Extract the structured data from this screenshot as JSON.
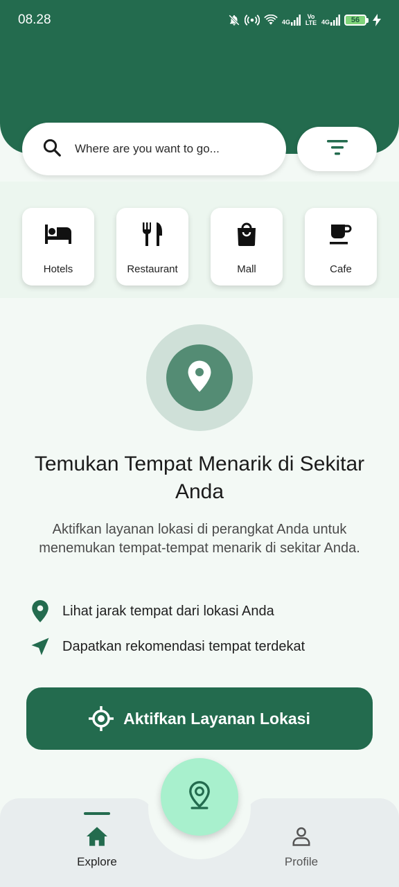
{
  "status_bar": {
    "time": "08.28",
    "network_1": "4G",
    "volte": "Vo LTE",
    "network_2": "4G",
    "battery": "56"
  },
  "search": {
    "placeholder": "Where are you want to go..."
  },
  "categories": [
    {
      "label": "Hotels",
      "icon": "bed-icon"
    },
    {
      "label": "Restaurant",
      "icon": "fork-knife-icon"
    },
    {
      "label": "Mall",
      "icon": "shopping-bag-icon"
    },
    {
      "label": "Cafe",
      "icon": "coffee-cup-icon"
    }
  ],
  "location_prompt": {
    "title": "Temukan Tempat Menarik di Sekitar Anda",
    "description": "Aktifkan layanan lokasi di perangkat Anda untuk menemukan tempat-tempat menarik di sekitar Anda.",
    "features": [
      {
        "text": "Lihat jarak tempat dari lokasi Anda",
        "icon": "map-pin-icon"
      },
      {
        "text": "Dapatkan rekomendasi tempat terdekat",
        "icon": "navigation-arrow-icon"
      }
    ],
    "button_label": "Aktifkan Layanan Lokasi"
  },
  "bottom_nav": {
    "items": [
      {
        "label": "Explore",
        "icon": "home-icon",
        "active": true
      },
      {
        "label": "Profile",
        "icon": "person-icon",
        "active": false
      }
    ],
    "fab_icon": "map-pin-icon"
  },
  "colors": {
    "primary": "#236b4e",
    "background": "#f3f9f5",
    "fab": "#a8f0cd",
    "icon_ring_outer": "#cfe0d8",
    "icon_ring_inner": "#548c74"
  }
}
